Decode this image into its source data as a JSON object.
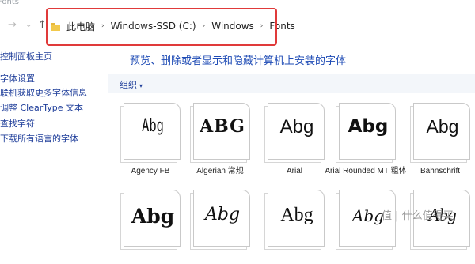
{
  "window": {
    "title": "Fonts"
  },
  "nav": {
    "forward": "→",
    "recent": "⌄",
    "up": "↑"
  },
  "breadcrumb": {
    "items": [
      "此电脑",
      "Windows-SSD (C:)",
      "Windows",
      "Fonts"
    ],
    "separator": "›"
  },
  "sidebar": {
    "items": [
      "控制面板主页",
      "字体设置",
      "联机获取更多字体信息",
      "调整 ClearType 文本",
      "查找字符",
      "下载所有语言的字体"
    ]
  },
  "main": {
    "heading": "预览、删除或者显示和隐藏计算机上安装的字体",
    "toolbar": {
      "organize_label": "组织",
      "organize_caret": "▾"
    },
    "fonts": [
      {
        "name": "Agency FB",
        "sample": "Abg"
      },
      {
        "name": "Algerian 常规",
        "sample": "ABG"
      },
      {
        "name": "Arial",
        "sample": "Abg"
      },
      {
        "name": "Arial Rounded MT 粗体",
        "sample": "Abg"
      },
      {
        "name": "Bahnschrift",
        "sample": "Abg"
      },
      {
        "name": "",
        "sample": "Abg"
      },
      {
        "name": "",
        "sample": "Abg"
      },
      {
        "name": "",
        "sample": "Abg"
      },
      {
        "name": "",
        "sample": "Abg"
      },
      {
        "name": "",
        "sample": "Abg"
      }
    ]
  },
  "watermark": {
    "text": "值 | 什么值得买"
  },
  "colors": {
    "link": "#1f3e9a",
    "heading": "#1e4bb5",
    "highlight_border": "#e03a3a"
  }
}
